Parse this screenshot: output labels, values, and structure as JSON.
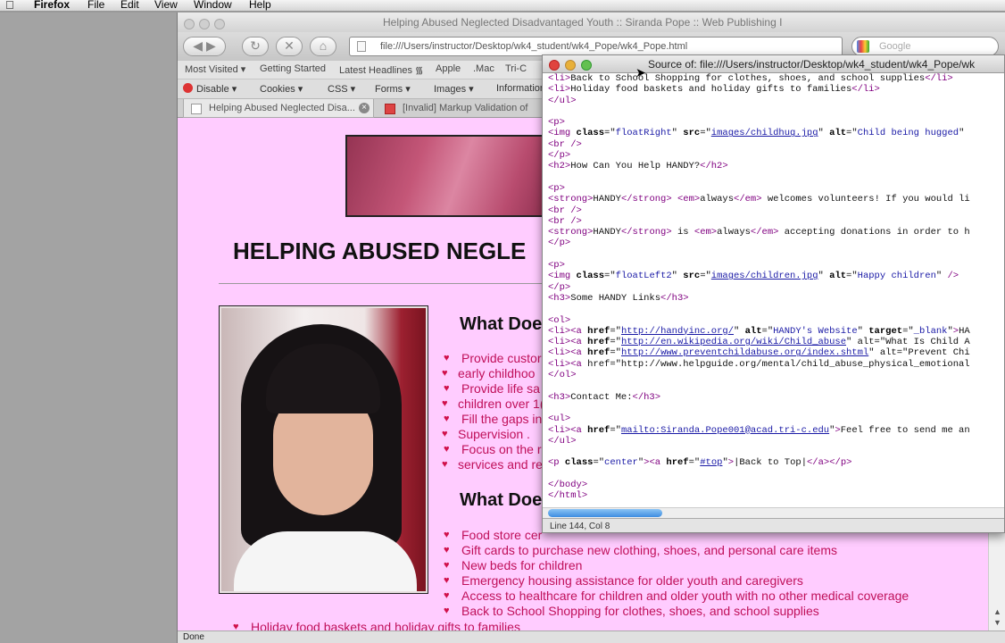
{
  "menubar": {
    "app": "Firefox",
    "items": [
      "File",
      "Edit",
      "View",
      "Window",
      "Help"
    ]
  },
  "browser": {
    "title": "Helping Abused Neglected Disadvantaged Youth :: Siranda Pope :: Web Publishing I",
    "url": "file:///Users/instructor/Desktop/wk4_student/wk4_Pope/wk4_Pope.html",
    "search_placeholder": "Google",
    "bookmarks": [
      "Most Visited ▾",
      "Getting Started",
      "Latest Headlines ᯾",
      "Apple",
      ".Mac",
      "Tri-C"
    ],
    "devbar": [
      "Disable ▾",
      "Cookies ▾",
      "CSS ▾",
      "Forms ▾",
      "Images ▾",
      "Information"
    ],
    "tabs": [
      {
        "label": "Helping Abused Neglected Disa..."
      },
      {
        "label": "[Invalid] Markup Validation of"
      }
    ],
    "status": "Done"
  },
  "page": {
    "heading": "HELPING ABUSED NEGLE",
    "section1": "What Doe",
    "list1": [
      [
        "Provide custor",
        "early childhoo"
      ],
      [
        "Provide life sa",
        "children over 1("
      ],
      [
        "Fill the gaps in",
        "Supervision ."
      ],
      [
        "Focus on the r",
        "services and re"
      ]
    ],
    "section2": "What Doe",
    "list2": [
      "Food store cer",
      "Gift cards to purchase new clothing, shoes, and personal care items",
      "New beds for children",
      "Emergency housing assistance for older youth and caregivers",
      "Access to healthcare for children and older youth with no other medical coverage",
      "Back to School Shopping for clothes, shoes, and school supplies"
    ],
    "list3": [
      "Holiday food baskets and holiday gifts to families"
    ]
  },
  "source_window": {
    "title": "Source of: file:///Users/instructor/Desktop/wk4_student/wk4_Pope/wk",
    "status": "Line 144, Col 8",
    "lines": [
      "<li>Back to School Shopping for clothes, shoes, and school supplies</li>",
      "<li>Holiday food baskets and holiday gifts to families</li>",
      "</ul>",
      "",
      "<p>",
      "<img class=\"floatRight\" src=\"images/childhug.jpg\" alt=\"Child being hugged\"",
      "<br />",
      "</p>",
      "<h2>How Can You Help HANDY?</h2>",
      "",
      "<p>",
      "<strong>HANDY</strong> <em>always</em> welcomes volunteers! If you would li",
      "<br />",
      "<br />",
      "<strong>HANDY</strong> is <em>always</em> accepting donations in order to h",
      "</p>",
      "",
      "<p>",
      "<img class=\"floatLeft2\" src=\"images/children.jpg\" alt=\"Happy children\" />",
      "</p>",
      "<h3>Some HANDY Links</h3>",
      "",
      "<ol>",
      "<li><a href=\"http://handyinc.org/\" alt=\"HANDY's Website\" target=\"_blank\">HA",
      "<li><a href=\"http://en.wikipedia.org/wiki/Child_abuse\" alt=\"What Is Child A",
      "<li><a href=\"http://www.preventchildabuse.org/index.shtml\" alt=\"Prevent Chi",
      "<li><a href=\"http://www.helpguide.org/mental/child_abuse_physical_emotional",
      "</ol>",
      "",
      "<h3>Contact Me:</h3>",
      "",
      "<ul>",
      "<li><a href=\"mailto:Siranda.Pope001@acad.tri-c.edu\">Feel free to send me an",
      "</ul>",
      "",
      "<p class=\"center\"><a href=\"#top\">|Back to Top|</a></p>",
      "",
      "</body>",
      "</html>"
    ]
  }
}
